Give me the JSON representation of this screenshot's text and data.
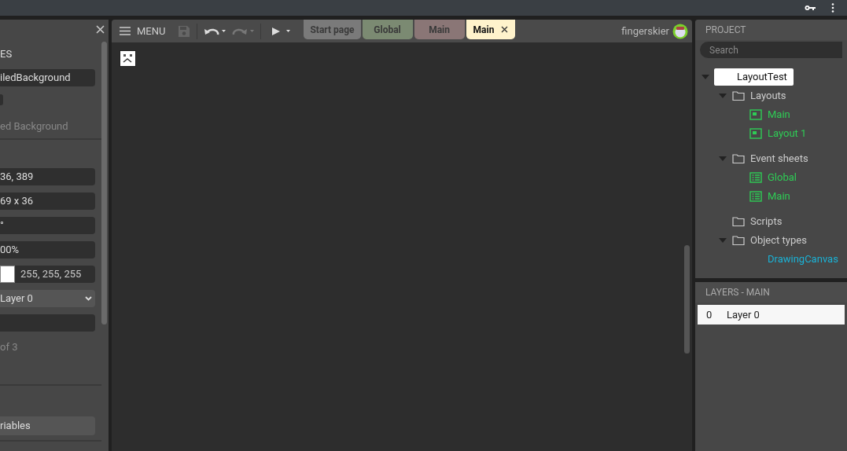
{
  "properties": {
    "heading": "ES",
    "name_value": "iledBackground",
    "plugin_text": "ed Background",
    "fields": [
      {
        "kind": "text",
        "value": "36, 389"
      },
      {
        "kind": "text",
        "value": "69 x 36"
      },
      {
        "kind": "text",
        "value": "°"
      },
      {
        "kind": "text",
        "value": "00%"
      },
      {
        "kind": "color",
        "value": "255, 255, 255",
        "color": "#ffffff"
      },
      {
        "kind": "select",
        "value": "Layer 0"
      },
      {
        "kind": "text"
      }
    ],
    "count_text": "of 3",
    "variables_button": "riables"
  },
  "toolbar": {
    "menu": "MENU",
    "user": "fingerskier"
  },
  "tabs": [
    {
      "label": "Start page",
      "selected": false,
      "color": "#7a7a7a"
    },
    {
      "label": "Global",
      "selected": false,
      "color": "#7b8a72"
    },
    {
      "label": "Main",
      "selected": false,
      "color": "#8a7676"
    },
    {
      "label": "Main",
      "selected": true,
      "color": "#fff3cc"
    }
  ],
  "project": {
    "title": "PROJECT",
    "search": {
      "placeholder": "Search"
    },
    "tree": [
      {
        "label": "LayoutTest",
        "kind": "root",
        "selected": true,
        "expanded": true,
        "children": [
          {
            "label": "Layouts",
            "kind": "folder",
            "expanded": true,
            "children": [
              {
                "label": "Main",
                "kind": "layout"
              },
              {
                "label": "Layout 1",
                "kind": "layout"
              }
            ]
          },
          {
            "label": "Event sheets",
            "kind": "folder",
            "expanded": true,
            "children": [
              {
                "label": "Global",
                "kind": "sheet"
              },
              {
                "label": "Main",
                "kind": "sheet"
              }
            ]
          },
          {
            "label": "Scripts",
            "kind": "folder",
            "expanded": false
          },
          {
            "label": "Object types",
            "kind": "folder",
            "expanded": true,
            "children": [
              {
                "label": "DrawingCanvas",
                "kind": "object"
              }
            ]
          }
        ]
      }
    ]
  },
  "layers": {
    "title": "LAYERS - MAIN",
    "rows": [
      {
        "index": "0",
        "name": "Layer 0",
        "selected": true
      }
    ]
  }
}
